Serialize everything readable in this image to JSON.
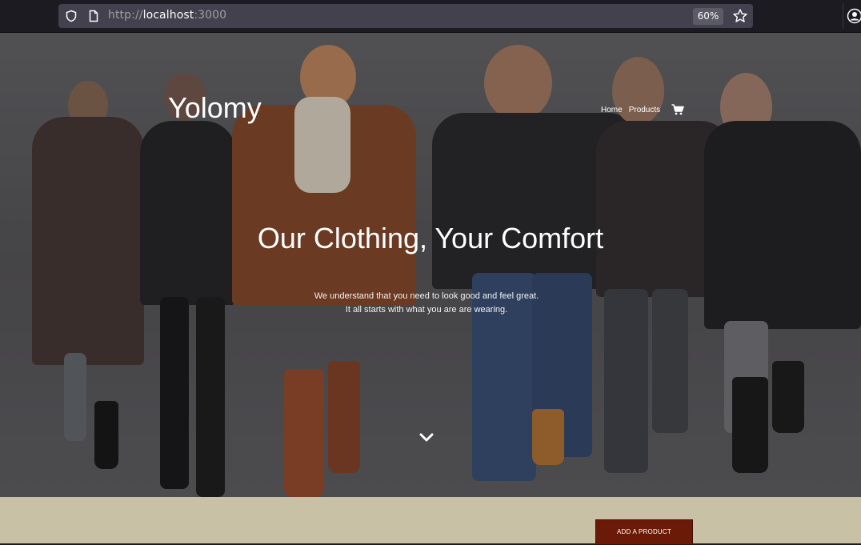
{
  "browser": {
    "url_scheme": "http://",
    "url_host": "localhost",
    "url_port": ":3000",
    "zoom": "60%",
    "icons": [
      "shield-icon",
      "page-icon",
      "star-icon",
      "account-icon"
    ]
  },
  "header": {
    "brand": "Yolomy",
    "nav": [
      {
        "label": "Home"
      },
      {
        "label": "Products"
      }
    ],
    "cart_icon": "cart-icon"
  },
  "hero": {
    "headline": "Our Clothing, Your Comfort",
    "sub_line1": "We understand that you need to look good and feel great.",
    "sub_line2": "It all starts with what you are are wearing.",
    "scroll_icon": "chevron-down-icon"
  },
  "products": {
    "add_button": "ADD A PRODUCT"
  },
  "colors": {
    "band": "#c9c1a6",
    "button": "#6b1a07",
    "chrome": "#1c1b22"
  }
}
